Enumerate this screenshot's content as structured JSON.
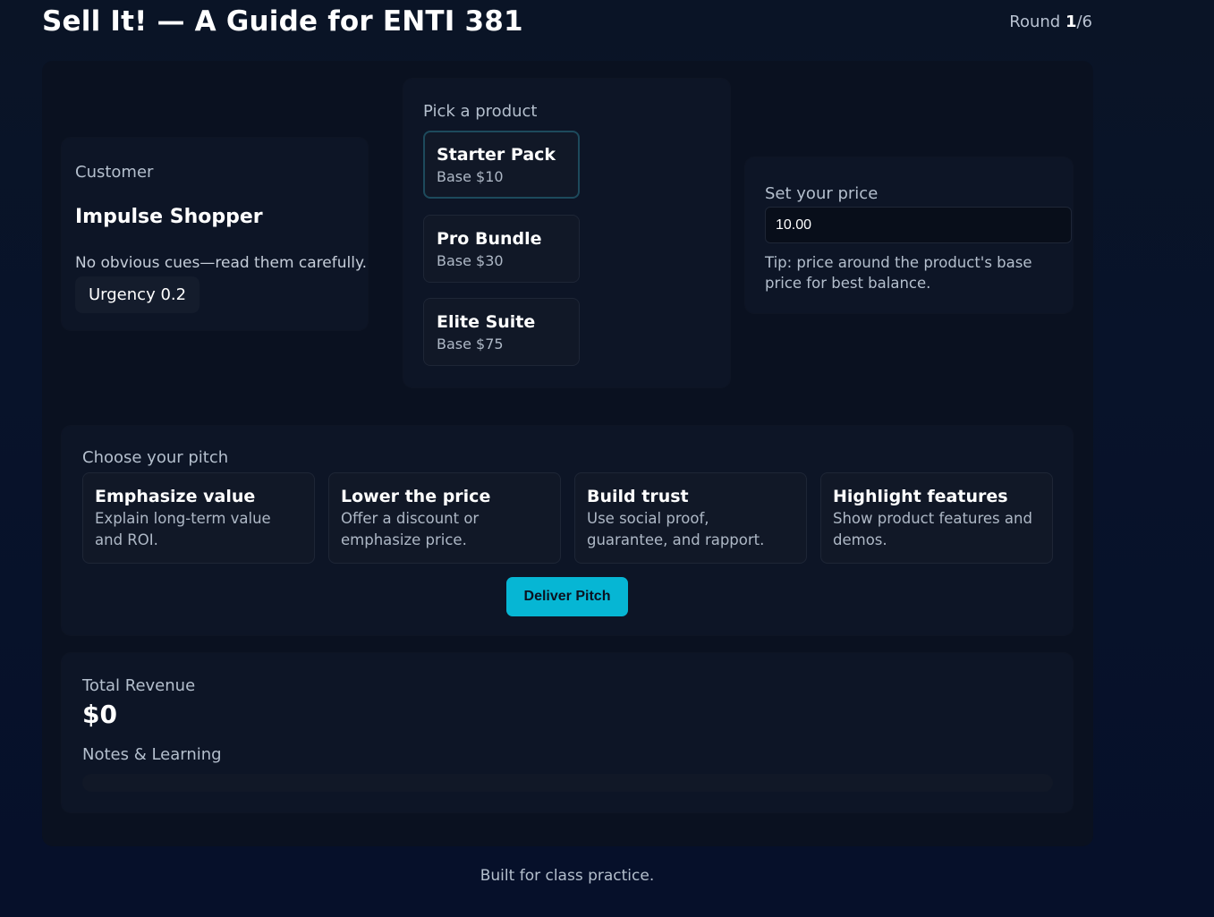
{
  "header": {
    "title": "Sell It! — A Guide for ENTI 381",
    "round_label": "Round",
    "round_current": "1",
    "round_total": "/6"
  },
  "customer": {
    "label": "Customer",
    "name": "Impulse Shopper",
    "description": "No obvious cues—read them carefully.",
    "urgency": "Urgency 0.2"
  },
  "products": {
    "label": "Pick a product",
    "items": [
      {
        "name": "Starter Pack",
        "base": "Base $10",
        "selected": true
      },
      {
        "name": "Pro Bundle",
        "base": "Base $30",
        "selected": false
      },
      {
        "name": "Elite Suite",
        "base": "Base $75",
        "selected": false
      }
    ]
  },
  "price": {
    "label": "Set your price",
    "value": "10.00",
    "tip": "Tip: price around the product's base price for best balance."
  },
  "pitch": {
    "label": "Choose your pitch",
    "options": [
      {
        "name": "Emphasize value",
        "desc": "Explain long-term value and ROI."
      },
      {
        "name": "Lower the price",
        "desc": "Offer a discount or emphasize price."
      },
      {
        "name": "Build trust",
        "desc": "Use social proof, guarantee, and rapport."
      },
      {
        "name": "Highlight features",
        "desc": "Show product features and demos."
      }
    ],
    "deliver_label": "Deliver Pitch"
  },
  "revenue": {
    "label": "Total Revenue",
    "value": "$0",
    "notes_label": "Notes & Learning"
  },
  "footer": {
    "text": "Built for class practice."
  }
}
